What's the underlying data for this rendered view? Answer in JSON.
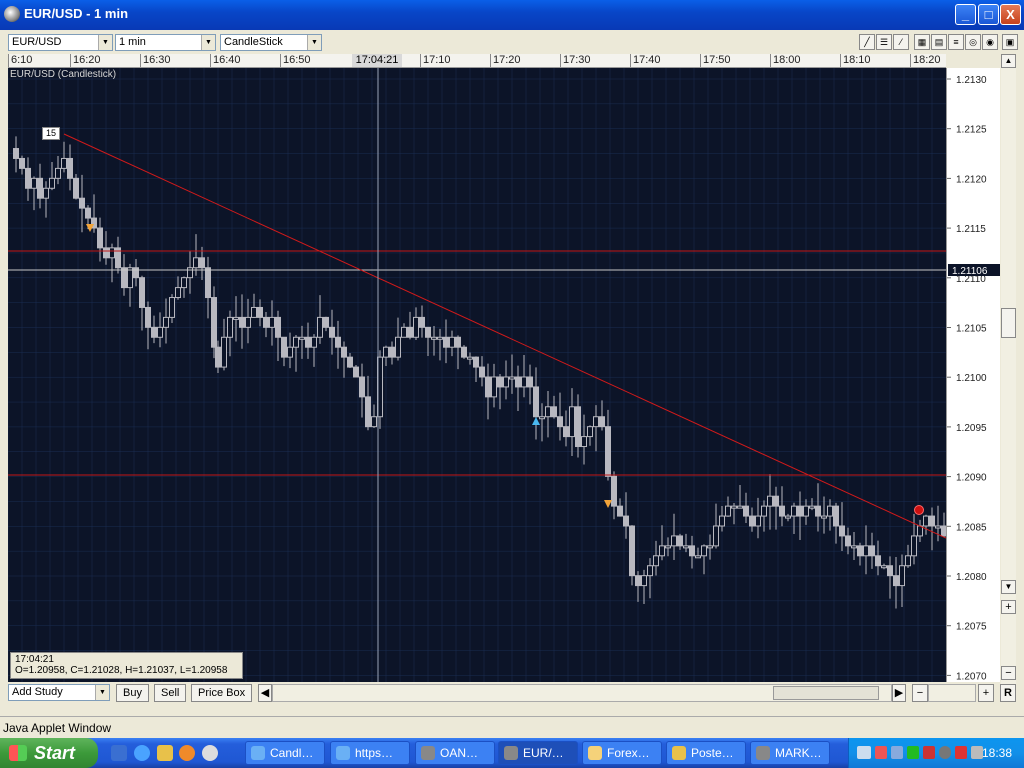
{
  "window": {
    "title": "EUR/USD - 1 min",
    "minimize_label": "_",
    "maximize_label": "□",
    "close_label": "X"
  },
  "toolbar": {
    "symbol": "EUR/USD",
    "interval": "1 min",
    "chart_type": "CandleStick"
  },
  "time_axis": {
    "labels": [
      "6:10",
      "16:20",
      "16:30",
      "16:40",
      "16:50",
      "17:10",
      "17:20",
      "17:30",
      "17:40",
      "17:50",
      "18:00",
      "18:10",
      "18:20"
    ],
    "cursor_label": "17:04:21"
  },
  "chart": {
    "title": "EUR/USD (Candlestick)",
    "trend_label": "15",
    "cursor_time": "17:04:21",
    "ohlc": "O=1.20958, C=1.21028, H=1.21037, L=1.20958",
    "line_colors": {
      "trend": "#d11a1a",
      "horizontal": "#c41616",
      "price": "#c8c8c8"
    },
    "candle_color": "#b8b8c0",
    "grid_color": "#1a2d52"
  },
  "price_axis": {
    "labels": [
      "1.2130",
      "1.2125",
      "1.2120",
      "1.2115",
      "1.2110",
      "1.2105",
      "1.2100",
      "1.2095",
      "1.2090",
      "1.2085",
      "1.2080",
      "1.2075",
      "1.2070"
    ],
    "current_price": "1.21106"
  },
  "bottom": {
    "add_study": "Add Study",
    "buy": "Buy",
    "sell": "Sell",
    "price_box": "Price Box"
  },
  "status": "Java Applet Window",
  "taskbar": {
    "start": "Start",
    "tasks": [
      "Candl…",
      "https…",
      "OAN…",
      "EUR/…",
      "Forex…",
      "Poste…",
      "MARK…"
    ],
    "clock": "18:38"
  }
}
